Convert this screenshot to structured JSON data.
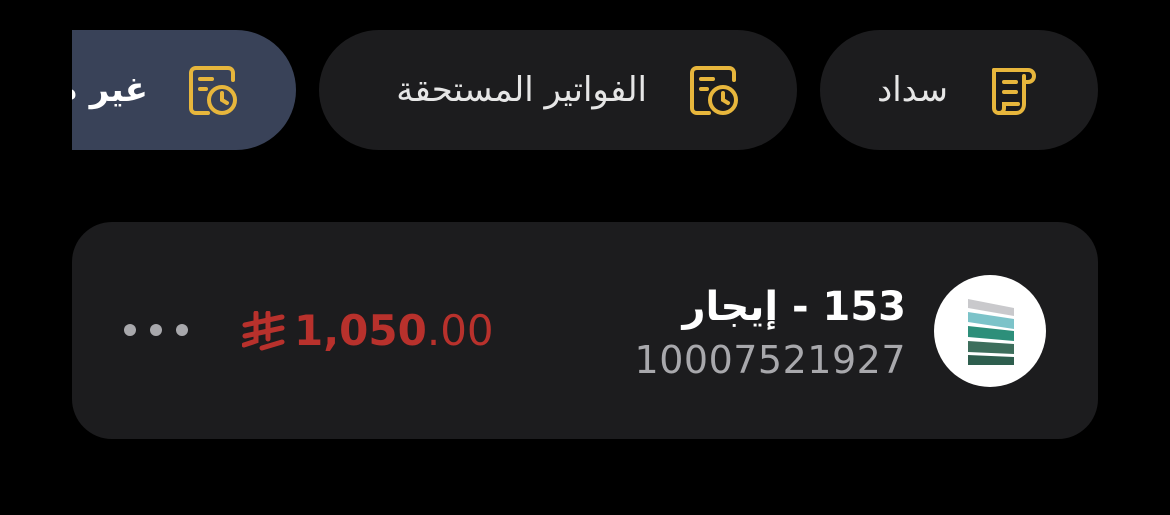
{
  "filters": {
    "chips": [
      {
        "label": "سداد",
        "icon": "receipt-icon",
        "active": false
      },
      {
        "label": "الفواتير المستحقة",
        "icon": "clock-receipt-icon",
        "active": false
      },
      {
        "label": "غير م",
        "icon": "clock-receipt-icon",
        "active": true
      }
    ]
  },
  "bill": {
    "title": "153 - إيجار",
    "account_number": "10007521927",
    "amount_integer": "1,050",
    "amount_decimal": ".00",
    "currency_icon": "saudi-riyal-icon",
    "more_icon": "more-dots-icon",
    "logo_icon": "biller-logo-icon"
  },
  "colors": {
    "background": "#000000",
    "surface": "#1c1c1e",
    "active_chip": "#394258",
    "icon_gold": "#e7b63c",
    "amount_red": "#b8312c",
    "secondary_text": "#a8a8ac"
  }
}
